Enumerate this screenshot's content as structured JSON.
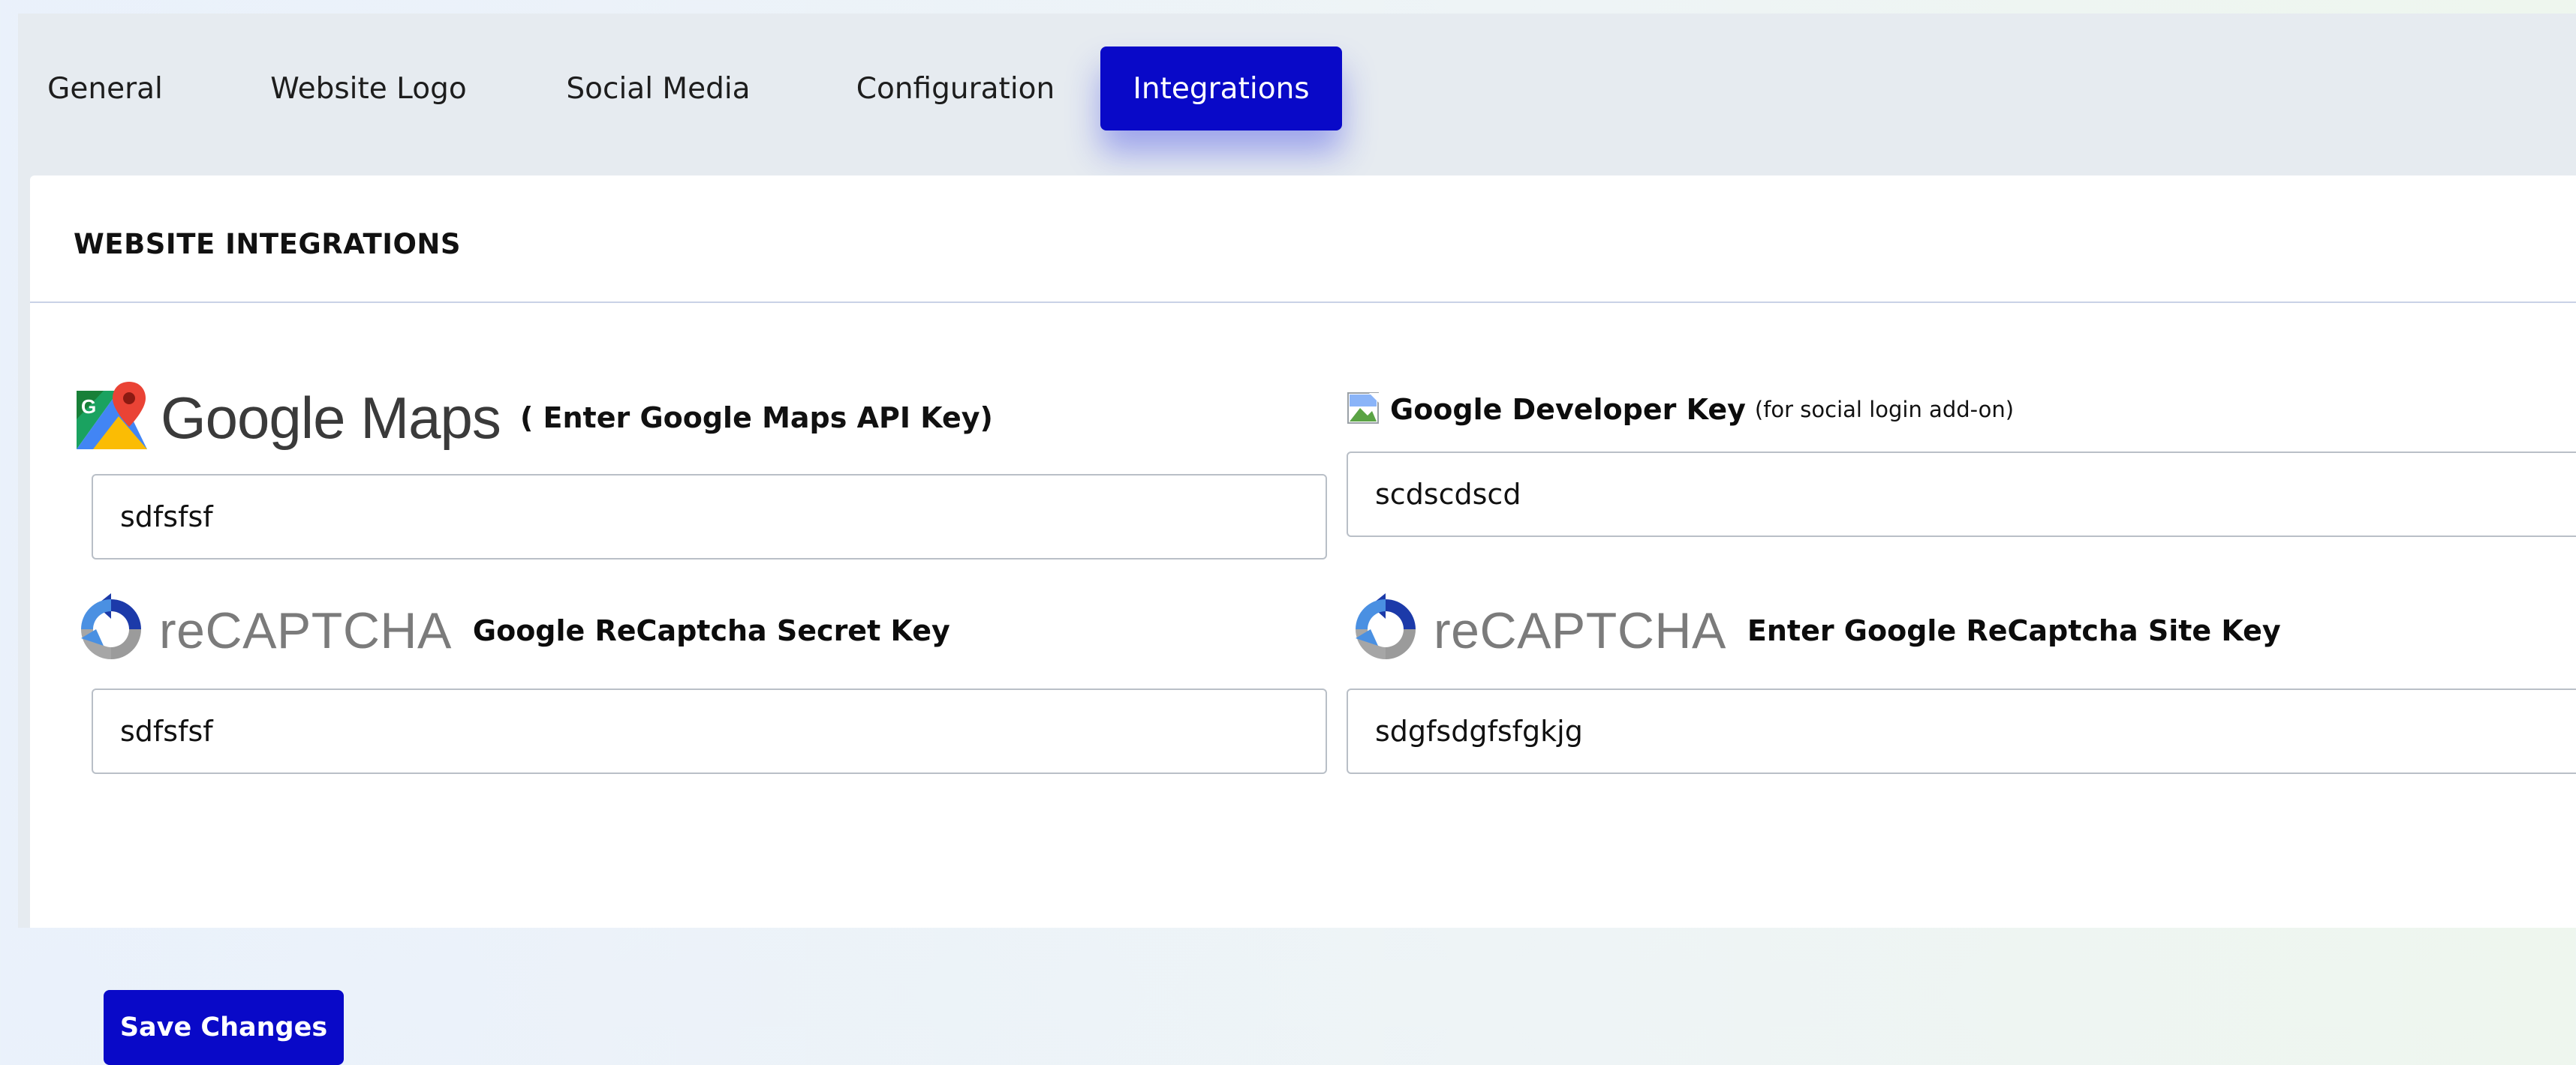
{
  "tabs": [
    {
      "label": "General"
    },
    {
      "label": "Website Logo"
    },
    {
      "label": "Social Media"
    },
    {
      "label": "Configuration"
    },
    {
      "label": "Integrations",
      "active": true
    }
  ],
  "card": {
    "title": "WEBSITE INTEGRATIONS"
  },
  "google_maps": {
    "logo_text": "Google Maps",
    "label": "( Enter Google Maps API Key)",
    "value": "sdfsfsf"
  },
  "google_developer": {
    "label": "Google Developer Key",
    "note": "(for social login add-on)",
    "value": "scdscdscd"
  },
  "recaptcha_secret": {
    "logo_text": "reCAPTCHA",
    "label": "Google ReCaptcha Secret Key",
    "value": "sdfsfsf"
  },
  "recaptcha_site": {
    "logo_text": "reCAPTCHA",
    "label": "Enter Google ReCaptcha Site Key",
    "value": "sdgfsdgfsfgkjg"
  },
  "actions": {
    "save_label": "Save Changes"
  },
  "colors": {
    "accent": "#0909c8",
    "panel_bg": "#e6ebf0",
    "card_bg": "#ffffff"
  }
}
